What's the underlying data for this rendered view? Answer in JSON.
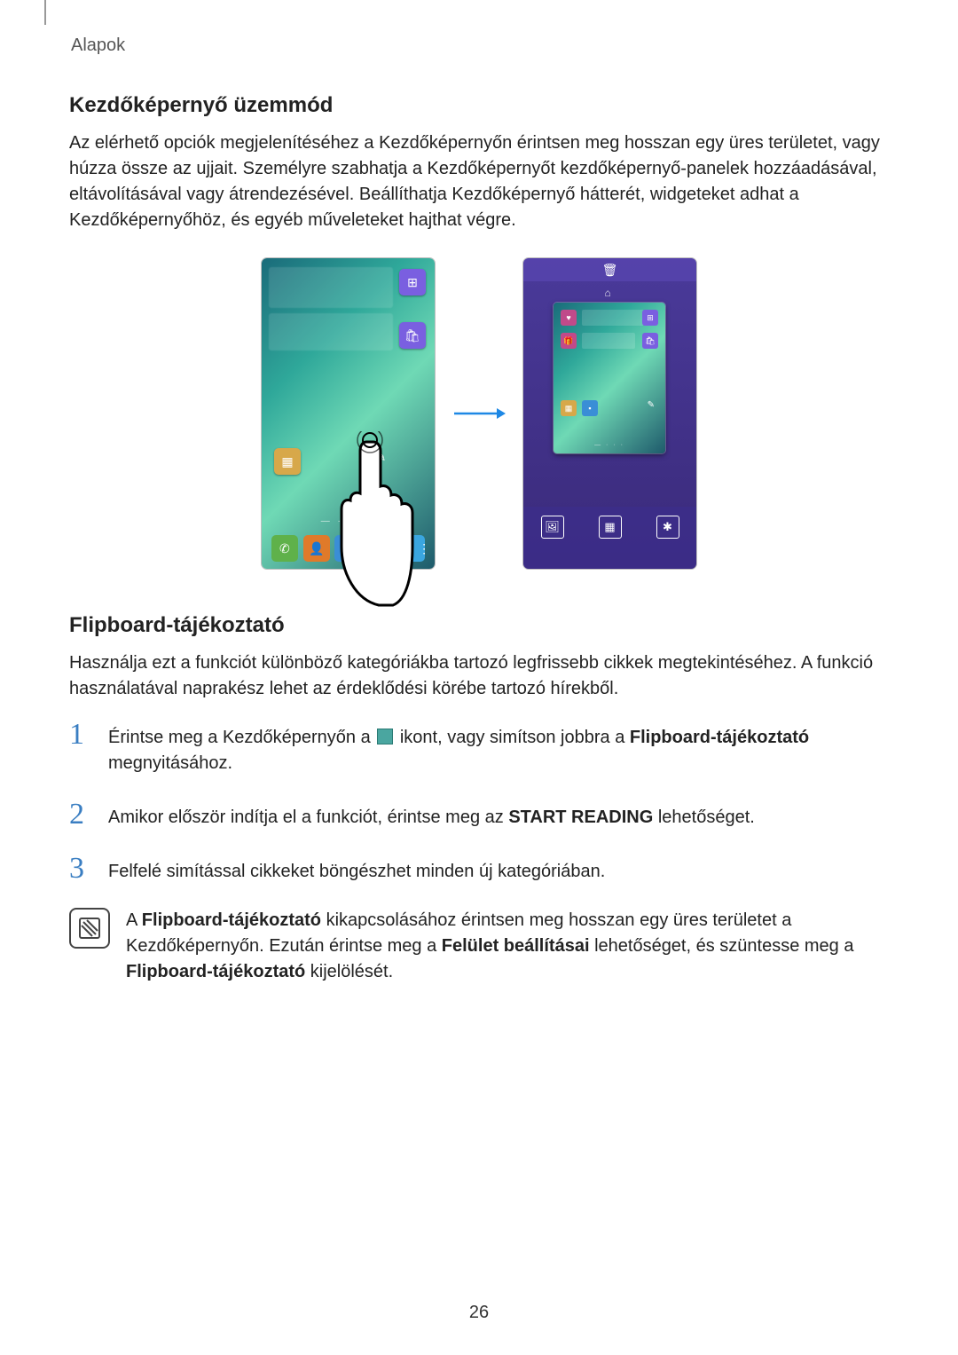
{
  "header": {
    "section": "Alapok"
  },
  "s1": {
    "title": "Kezdőképernyő üzemmód",
    "body": "Az elérhető opciók megjelenítéséhez a Kezdőképernyőn érintsen meg hosszan egy üres területet, vagy húzza össze az ujjait. Személyre szabhatja a Kezdőképernyőt kezdőképernyő-panelek hozzáadásával, eltávolításával vagy átrendezésével. Beállíthatja Kezdőképernyő hátterét, widgeteket adhat a Kezdőképernyőhöz, és egyéb műveleteket hajthat végre."
  },
  "icons": {
    "trash": "trash-icon",
    "home": "home-icon",
    "wallpaper": "wallpaper-icon",
    "widgets": "widgets-icon",
    "settings": "settings-icon",
    "flipboard_inline": "flipboard-icon"
  },
  "s2": {
    "title": "Flipboard-tájékoztató",
    "body": "Használja ezt a funkciót különböző kategóriákba tartozó legfrissebb cikkek megtekintéséhez. A funkció használatával naprakész lehet az érdeklődési körébe tartozó hírekből.",
    "steps": [
      {
        "num": "1",
        "pre": "Érintse meg a Kezdőképernyőn a ",
        "post_a": " ikont, vagy simítson jobbra a ",
        "bold_a": "Flipboard-tájékoztató",
        "post_b": " megnyitásához."
      },
      {
        "num": "2",
        "pre": "Amikor először indítja el a funkciót, érintse meg az ",
        "bold_a": "START READING",
        "post_a": " lehetőséget."
      },
      {
        "num": "3",
        "pre": "Felfelé simítással cikkeket böngészhet minden új kategóriában."
      }
    ],
    "note": {
      "a": "A ",
      "b1": "Flipboard-tájékoztató",
      "c": " kikapcsolásához érintsen meg hosszan egy üres területet a Kezdőképernyőn. Ezután érintse meg a ",
      "b2": "Felület beállításai",
      "d": " lehetőséget, és szüntesse meg a ",
      "b3": "Flipboard-tájékoztató",
      "e": " kijelölését."
    }
  },
  "page_number": "26"
}
